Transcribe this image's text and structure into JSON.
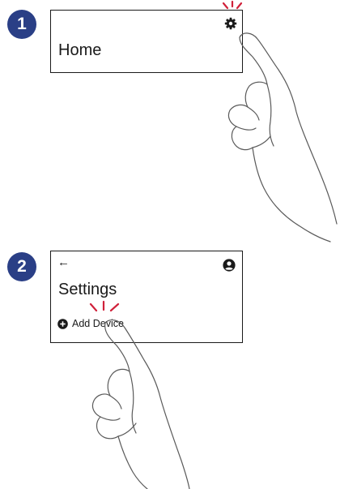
{
  "steps": [
    {
      "number": "1",
      "screen": {
        "title": "Home",
        "settings_icon": "gear-icon"
      }
    },
    {
      "number": "2",
      "screen": {
        "back_label": "←",
        "title": "Settings",
        "account_icon": "user-icon",
        "add_device_label": "Add Device",
        "add_device_icon": "plus-circle-icon"
      }
    }
  ],
  "colors": {
    "badge": "#2a3f86",
    "tap_highlight": "#d0213a",
    "ink": "#1a1a1a"
  }
}
